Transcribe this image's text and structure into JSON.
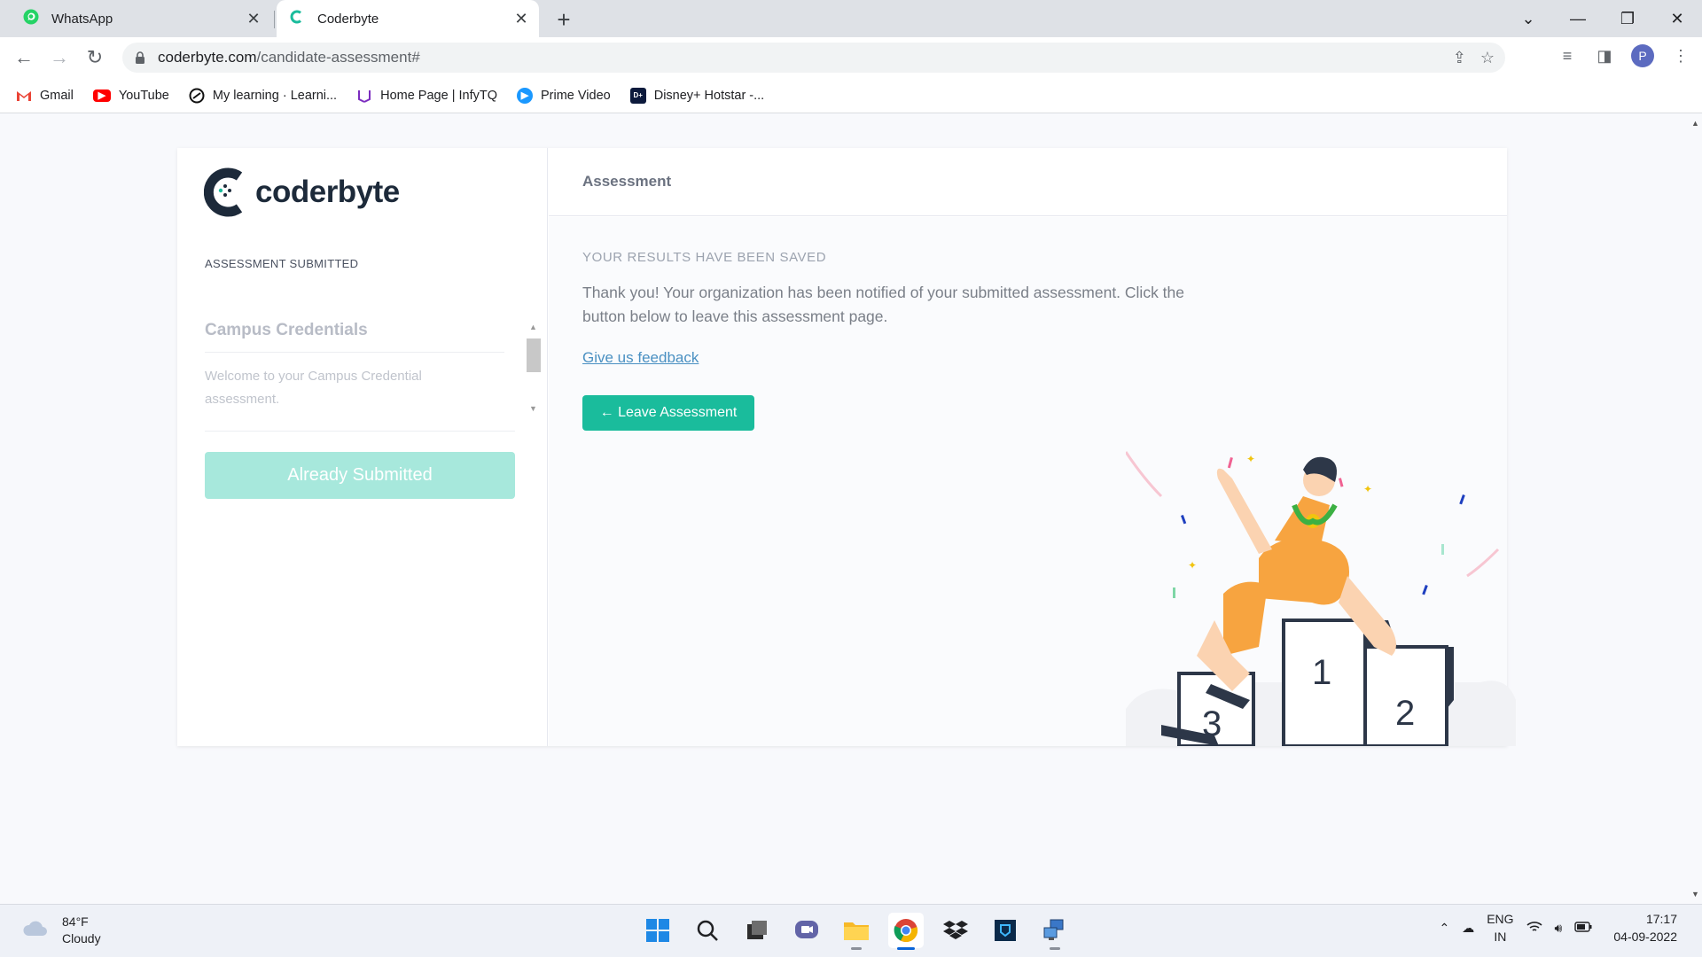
{
  "browser": {
    "tabs": [
      {
        "title": "WhatsApp",
        "active": false,
        "icon": "whatsapp-icon"
      },
      {
        "title": "Coderbyte",
        "active": true,
        "icon": "coderbyte-icon"
      }
    ],
    "url_domain": "coderbyte.com",
    "url_path": "/candidate-assessment#",
    "profile_initial": "P",
    "bookmarks": [
      {
        "label": "Gmail",
        "icon": "gmail-icon"
      },
      {
        "label": "YouTube",
        "icon": "youtube-icon"
      },
      {
        "label": "My learning · Learni...",
        "icon": "learning-icon"
      },
      {
        "label": "Home Page | InfyTQ",
        "icon": "infytq-icon"
      },
      {
        "label": "Prime Video",
        "icon": "prime-video-icon"
      },
      {
        "label": "Disney+ Hotstar -...",
        "icon": "hotstar-icon"
      }
    ]
  },
  "sidebar": {
    "logo_text": "coderbyte",
    "status": "ASSESSMENT SUBMITTED",
    "section_title": "Campus Credentials",
    "section_text": "Welcome to your Campus Credential assessment.",
    "submit_button": "Already Submitted"
  },
  "main": {
    "header_title": "Assessment",
    "results_label": "YOUR RESULTS HAVE BEEN SAVED",
    "thanks_text": "Thank you! Your organization has been notified of your submitted assessment. Click the button below to leave this assessment page.",
    "feedback_link": "Give us feedback",
    "leave_button": "← Leave Assessment",
    "podium": {
      "first": "1",
      "second": "2",
      "third": "3"
    }
  },
  "taskbar": {
    "temperature": "84°F",
    "weather": "Cloudy",
    "lang_primary": "ENG",
    "lang_secondary": "IN",
    "time": "17:17",
    "date": "04-09-2022"
  },
  "colors": {
    "accent": "#1abc9c",
    "accent_disabled": "#a7e8dc",
    "link": "#4a90c2",
    "brand_dark": "#1d2a3a"
  }
}
